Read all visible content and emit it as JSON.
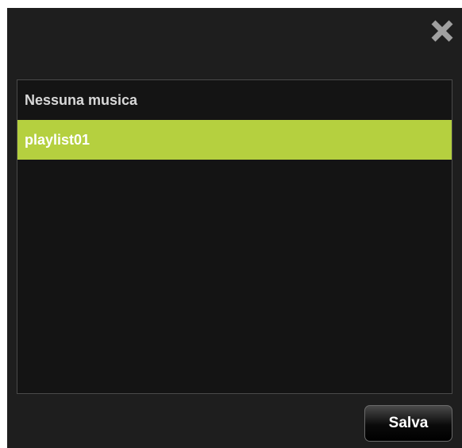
{
  "dialog": {
    "close_icon": "close-icon",
    "list": {
      "items": [
        {
          "label": "Nessuna musica",
          "selected": false
        },
        {
          "label": "playlist01",
          "selected": true
        }
      ]
    },
    "save_label": "Salva"
  },
  "colors": {
    "background": "#1e1e1e",
    "list_background": "#141414",
    "selected_item": "#b5d03f",
    "close_icon": "#a0a0a0"
  }
}
